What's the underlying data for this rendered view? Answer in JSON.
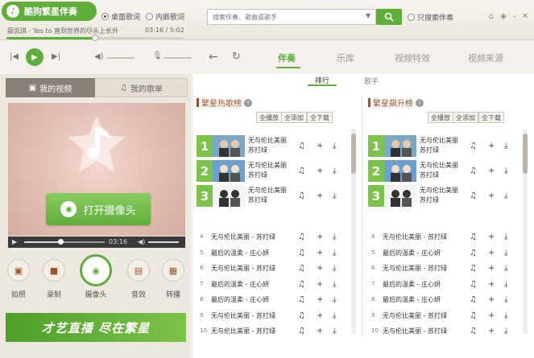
{
  "app": {
    "title": "酷狗繁星伴奏",
    "desktop_lyric": "桌面歌词",
    "inline_lyric": "内嵌歌词"
  },
  "now_playing": {
    "artist_line": "薛凯琪 - Yes to 直到世界的尽头上长升",
    "time": "03:16 / 5:02",
    "progress": 0.5
  },
  "search": {
    "placeholder": "搜索伴奏、歌曲或歌手",
    "only_accompaniment": "只搜索伴奏"
  },
  "main_tabs": [
    "伴奏",
    "乐库",
    "视频特效",
    "视频来源"
  ],
  "left": {
    "video_tab": "我的视频",
    "songs_tab": "我的歌单",
    "camera_button": "打开摄像头",
    "video_time": "03:16",
    "tools": [
      "拍照",
      "录制",
      "摄像头",
      "音效",
      "转播"
    ],
    "banner": "才艺直播 尽在繁星"
  },
  "sub_tabs": {
    "rank": "排行",
    "singer": "歌手"
  },
  "charts": [
    {
      "title": "繁星热歌榜",
      "buttons": [
        "全播放",
        "全添加",
        "全下载"
      ],
      "top3": [
        {
          "rank": "1",
          "title": "无与伦比美丽",
          "artist": "苏打绿"
        },
        {
          "rank": "2",
          "title": "无与伦比美丽",
          "artist": "苏打绿"
        },
        {
          "rank": "3",
          "title": "无与伦比美丽",
          "artist": "苏打绿"
        }
      ],
      "rows": [
        {
          "n": "4",
          "text": "无与伦比美丽 - 苏打绿"
        },
        {
          "n": "5",
          "text": "最后的温柔 - 庄心妍"
        },
        {
          "n": "6",
          "text": "无与伦比美丽 - 苏打绿"
        },
        {
          "n": "7",
          "text": "最后的温柔 - 庄心妍"
        },
        {
          "n": "8",
          "text": "最后的温柔 - 庄心妍"
        },
        {
          "n": "9",
          "text": "无与伦比美丽 - 苏打绿"
        },
        {
          "n": "10",
          "text": "无与伦比美丽 - 苏打绿"
        }
      ]
    },
    {
      "title": "繁星飙升榜",
      "buttons": [
        "全播放",
        "全添加",
        "全下载"
      ],
      "top3": [
        {
          "rank": "1",
          "title": "无与伦比美丽",
          "artist": "苏打绿"
        },
        {
          "rank": "2",
          "title": "无与伦比美丽",
          "artist": "苏打绿"
        },
        {
          "rank": "3",
          "title": "无与伦比美丽",
          "artist": "苏打绿"
        }
      ],
      "rows": [
        {
          "n": "4",
          "text": "无与伦比美丽 - 苏打绿"
        },
        {
          "n": "5",
          "text": "最后的温柔 - 庄心妍"
        },
        {
          "n": "6",
          "text": "无与伦比美丽 - 苏打绿"
        },
        {
          "n": "7",
          "text": "最后的温柔 - 庄心妍"
        },
        {
          "n": "8",
          "text": "最后的温柔 - 庄心妍"
        },
        {
          "n": "9",
          "text": "无与伦比美丽 - 苏打绿"
        },
        {
          "n": "10",
          "text": "无与伦比美丽 - 苏打绿"
        }
      ]
    }
  ],
  "colors": {
    "accent": "#5fae3a",
    "rank_green": "#7cc34a",
    "chart_title": "#a0522d"
  }
}
